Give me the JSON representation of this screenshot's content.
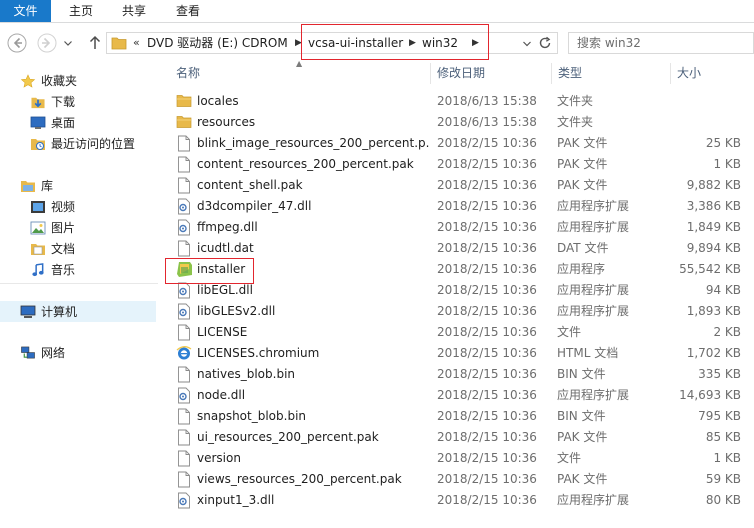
{
  "ribbon": {
    "tabs": [
      {
        "label": "文件"
      },
      {
        "label": "主页"
      },
      {
        "label": "共享"
      },
      {
        "label": "查看"
      }
    ]
  },
  "address": {
    "overflow": "«",
    "crumbs": [
      "DVD 驱动器 (E:) CDROM",
      "vcsa-ui-installer",
      "win32"
    ]
  },
  "search": {
    "placeholder": "搜索 win32"
  },
  "nav": {
    "favorites": "收藏夹",
    "favorite_items": [
      "下载",
      "桌面",
      "最近访问的位置"
    ],
    "libraries": "库",
    "library_items": [
      "视频",
      "图片",
      "文档",
      "音乐"
    ],
    "computer": "计算机",
    "network": "网络"
  },
  "columns": {
    "name": "名称",
    "date": "修改日期",
    "type": "类型",
    "size": "大小"
  },
  "files": [
    {
      "name": "locales",
      "date": "2018/6/13 15:38",
      "type": "文件夹",
      "size": "",
      "icon": "folder-icon"
    },
    {
      "name": "resources",
      "date": "2018/6/13 15:38",
      "type": "文件夹",
      "size": "",
      "icon": "folder-icon"
    },
    {
      "name": "blink_image_resources_200_percent.p...",
      "date": "2018/2/15 10:36",
      "type": "PAK 文件",
      "size": "25 KB",
      "icon": "file-icon"
    },
    {
      "name": "content_resources_200_percent.pak",
      "date": "2018/2/15 10:36",
      "type": "PAK 文件",
      "size": "1 KB",
      "icon": "file-icon"
    },
    {
      "name": "content_shell.pak",
      "date": "2018/2/15 10:36",
      "type": "PAK 文件",
      "size": "9,882 KB",
      "icon": "file-icon"
    },
    {
      "name": "d3dcompiler_47.dll",
      "date": "2018/2/15 10:36",
      "type": "应用程序扩展",
      "size": "3,386 KB",
      "icon": "dll-icon"
    },
    {
      "name": "ffmpeg.dll",
      "date": "2018/2/15 10:36",
      "type": "应用程序扩展",
      "size": "1,849 KB",
      "icon": "dll-icon"
    },
    {
      "name": "icudtl.dat",
      "date": "2018/2/15 10:36",
      "type": "DAT 文件",
      "size": "9,894 KB",
      "icon": "file-icon"
    },
    {
      "name": "installer",
      "date": "2018/2/15 10:36",
      "type": "应用程序",
      "size": "55,542 KB",
      "icon": "installer-icon"
    },
    {
      "name": "libEGL.dll",
      "date": "2018/2/15 10:36",
      "type": "应用程序扩展",
      "size": "94 KB",
      "icon": "dll-icon"
    },
    {
      "name": "libGLESv2.dll",
      "date": "2018/2/15 10:36",
      "type": "应用程序扩展",
      "size": "1,893 KB",
      "icon": "dll-icon"
    },
    {
      "name": "LICENSE",
      "date": "2018/2/15 10:36",
      "type": "文件",
      "size": "2 KB",
      "icon": "file-icon"
    },
    {
      "name": "LICENSES.chromium",
      "date": "2018/2/15 10:36",
      "type": "HTML 文档",
      "size": "1,702 KB",
      "icon": "ie-html-icon"
    },
    {
      "name": "natives_blob.bin",
      "date": "2018/2/15 10:36",
      "type": "BIN 文件",
      "size": "335 KB",
      "icon": "file-icon"
    },
    {
      "name": "node.dll",
      "date": "2018/2/15 10:36",
      "type": "应用程序扩展",
      "size": "14,693 KB",
      "icon": "dll-icon"
    },
    {
      "name": "snapshot_blob.bin",
      "date": "2018/2/15 10:36",
      "type": "BIN 文件",
      "size": "795 KB",
      "icon": "file-icon"
    },
    {
      "name": "ui_resources_200_percent.pak",
      "date": "2018/2/15 10:36",
      "type": "PAK 文件",
      "size": "85 KB",
      "icon": "file-icon"
    },
    {
      "name": "version",
      "date": "2018/2/15 10:36",
      "type": "文件",
      "size": "1 KB",
      "icon": "file-icon"
    },
    {
      "name": "views_resources_200_percent.pak",
      "date": "2018/2/15 10:36",
      "type": "PAK 文件",
      "size": "59 KB",
      "icon": "file-icon"
    },
    {
      "name": "xinput1_3.dll",
      "date": "2018/2/15 10:36",
      "type": "应用程序扩展",
      "size": "80 KB",
      "icon": "dll-icon"
    }
  ],
  "colors": {
    "file_tab": "#1979ca",
    "highlight": "#e2262e",
    "folder": "#e8b94a",
    "header_text": "#4c607a"
  }
}
